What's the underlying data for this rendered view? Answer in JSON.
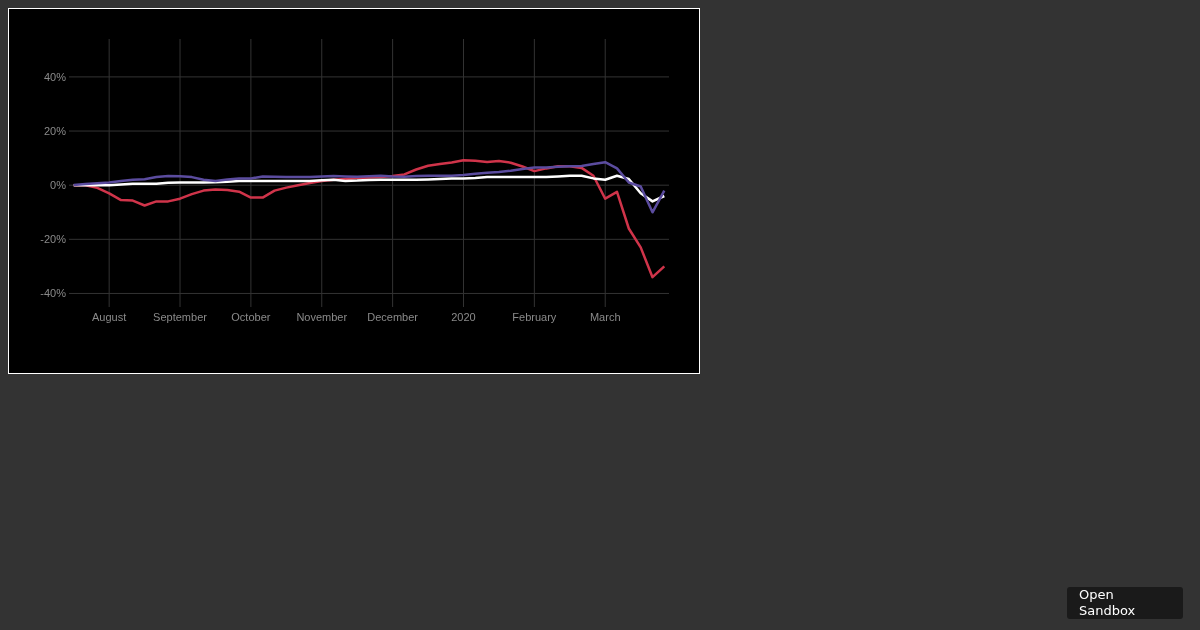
{
  "chart": {
    "chart_data": {
      "type": "line",
      "categories": [
        null,
        null,
        null,
        "August",
        null,
        null,
        null,
        null,
        null,
        "September",
        null,
        null,
        null,
        null,
        null,
        "October",
        null,
        null,
        null,
        null,
        null,
        "November",
        null,
        null,
        null,
        null,
        null,
        "December",
        null,
        null,
        null,
        null,
        null,
        "2020",
        null,
        null,
        null,
        null,
        null,
        "February",
        null,
        null,
        null,
        null,
        null,
        "March",
        null,
        null,
        null,
        null,
        null
      ],
      "grid": true,
      "ylim": [
        -45,
        54
      ],
      "yticks": [
        {
          "value": 40,
          "label": "40%"
        },
        {
          "value": 20,
          "label": "20%"
        },
        {
          "value": 0,
          "label": "0%"
        },
        {
          "value": -20,
          "label": "-20%"
        },
        {
          "value": -40,
          "label": "-40%"
        }
      ],
      "series": [
        {
          "color": "#d0344a",
          "values": [
            0,
            0,
            -1,
            -3,
            -5.5,
            -5.7,
            -7.5,
            -6,
            -6,
            -5,
            -3.3,
            -2,
            -1.6,
            -1.8,
            -2.4,
            -4.6,
            -4.6,
            -2,
            -0.9,
            0,
            0.8,
            1.5,
            2,
            2.3,
            2.6,
            2.8,
            3,
            3.4,
            4,
            5.8,
            7.2,
            7.8,
            8.4,
            9.2,
            9,
            8.6,
            8.9,
            8.3,
            6.9,
            5.2,
            6.2,
            7,
            7,
            6.4,
            3.5,
            -5,
            -2.5,
            -16,
            -23,
            -34,
            -30
          ]
        },
        {
          "color": "#ffffff",
          "values": [
            0,
            0,
            0,
            0,
            0.2,
            0.5,
            0.5,
            0.5,
            0.9,
            1,
            1,
            1,
            1.1,
            1.3,
            1.5,
            1.5,
            1.5,
            1.5,
            1.5,
            1.5,
            1.5,
            1.8,
            2,
            1.6,
            1.7,
            1.9,
            2,
            2,
            2,
            2,
            2.1,
            2.3,
            2.5,
            2.5,
            2.7,
            3,
            3,
            3,
            3,
            3,
            3,
            3.2,
            3.5,
            3.5,
            2.5,
            2,
            3.5,
            2.3,
            -3,
            -6,
            -4
          ]
        },
        {
          "color": "#5b4c9f",
          "values": [
            0.1,
            0.4,
            0.7,
            1,
            1.5,
            2,
            2.2,
            3,
            3.4,
            3.3,
            3,
            2,
            1.6,
            2.1,
            2.5,
            2.5,
            3.2,
            3.1,
            3,
            3,
            3,
            3.2,
            3.4,
            3.2,
            3.1,
            3.3,
            3.5,
            3.2,
            3.1,
            3.4,
            3.5,
            3.5,
            3.5,
            3.8,
            4.2,
            4.6,
            4.9,
            5.3,
            6,
            6.5,
            6.5,
            6.8,
            7,
            7.1,
            7.8,
            8.5,
            6.2,
            1,
            -0.5,
            -10,
            -2
          ]
        }
      ]
    }
  },
  "open_sandbox_button": {
    "label": "Open Sandbox"
  }
}
